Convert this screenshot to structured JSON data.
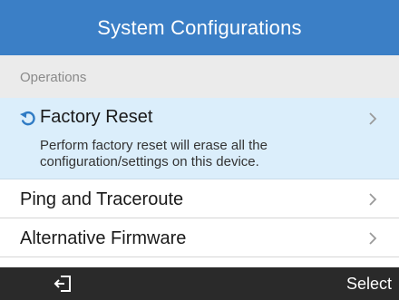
{
  "title": "System Configurations",
  "section": "Operations",
  "items": [
    {
      "label": "Factory Reset",
      "description_line1": "Perform factory reset will erase all the",
      "description_line2": "configuration/settings on this device.",
      "icon": "reset-arrow-icon",
      "selected": true
    },
    {
      "label": "Ping and Traceroute",
      "selected": false
    },
    {
      "label": "Alternative Firmware",
      "selected": false
    }
  ],
  "softkeys": {
    "left_icon": "back-exit-icon",
    "right_label": "Select"
  },
  "colors": {
    "title_bar": "#3b7fc6",
    "section_bg": "#ebebeb",
    "selected_bg": "#dbeefb",
    "softkey_bg": "#2a2a2a",
    "accent_icon": "#2f7bc4"
  }
}
